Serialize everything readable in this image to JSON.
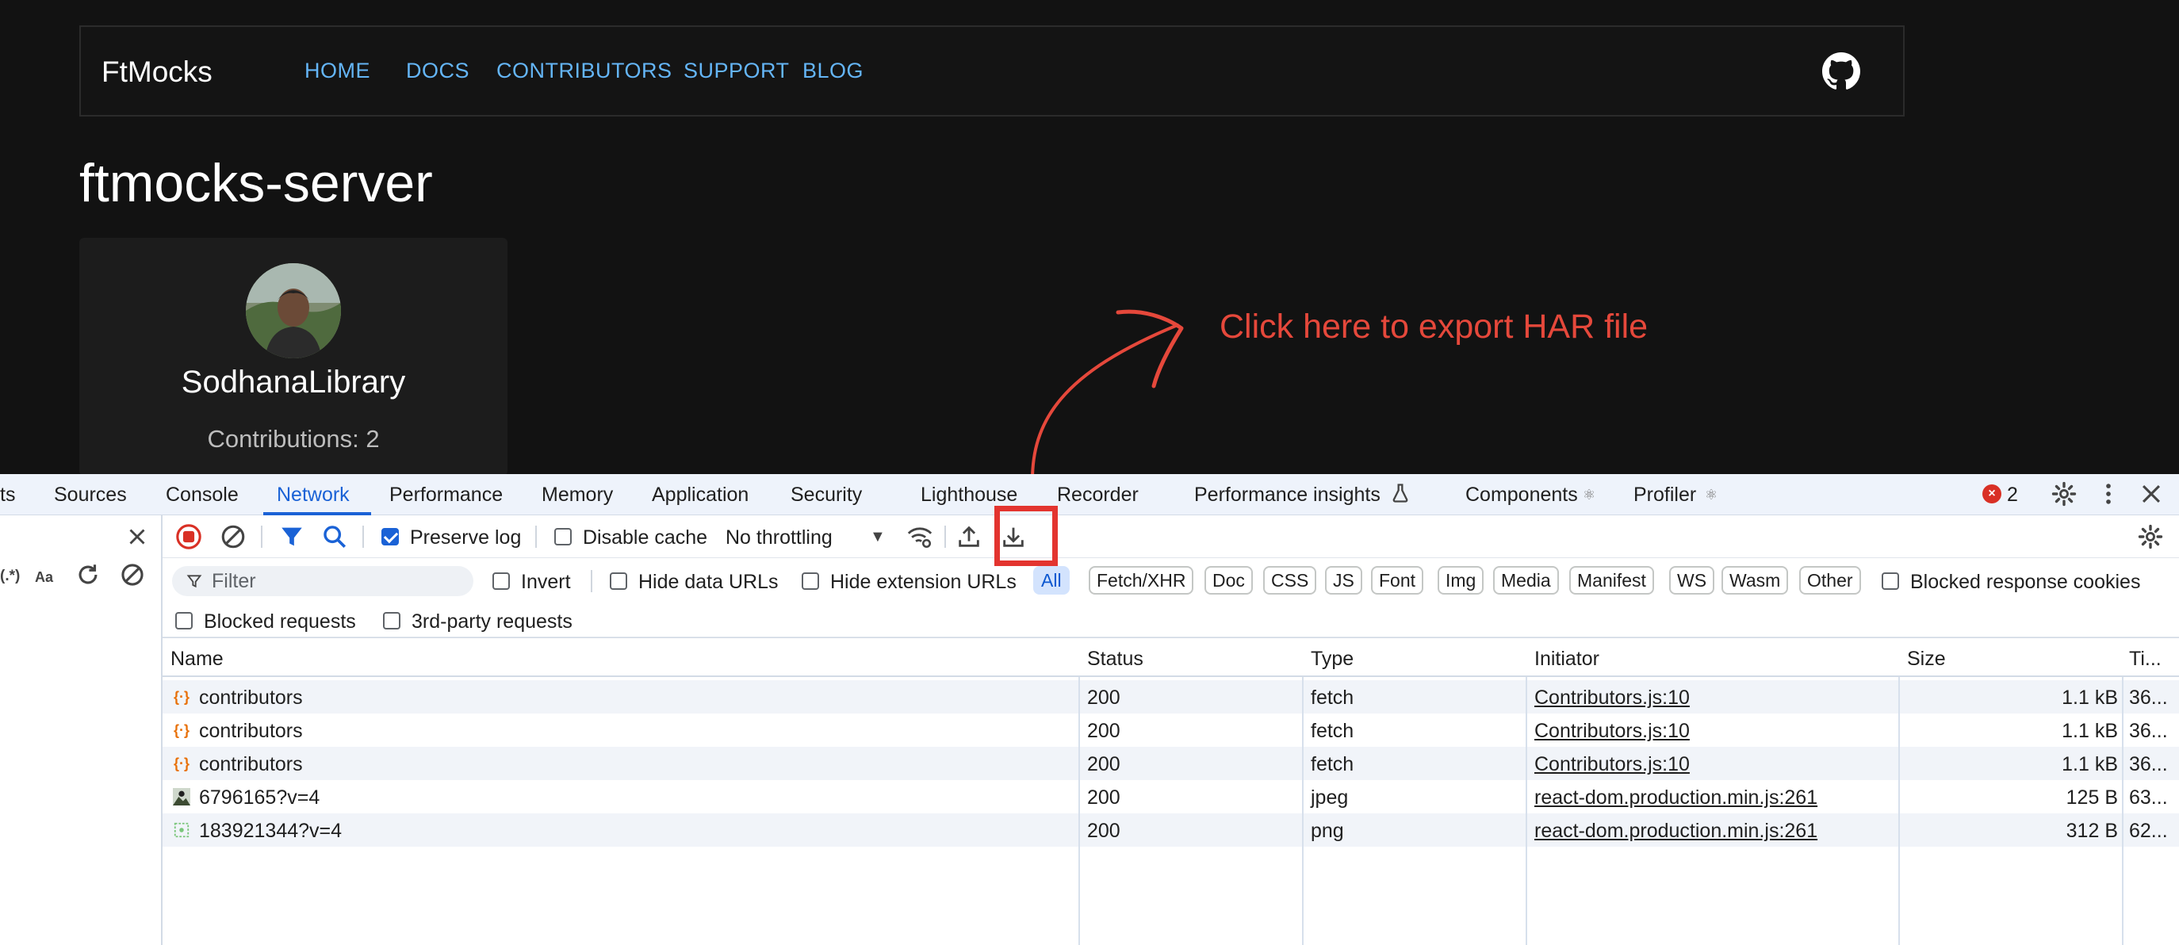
{
  "site": {
    "brand": "FtMocks",
    "nav": [
      "HOME",
      "DOCS",
      "CONTRIBUTORS",
      "SUPPORT",
      "BLOG"
    ],
    "github_icon": "github-icon",
    "page_title": "ftmocks-server",
    "card": {
      "name": "SodhanaLibrary",
      "contributions": "Contributions: 2"
    },
    "annotation": "Click here to export HAR file",
    "annotation_color": "#e5483b"
  },
  "devtools": {
    "tabs": [
      "ts",
      "Sources",
      "Console",
      "Network",
      "Performance",
      "Memory",
      "Application",
      "Security",
      "Lighthouse",
      "Recorder",
      "Performance insights",
      "Components",
      "Profiler"
    ],
    "active_tab": "Network",
    "error_count": "2",
    "toolbar": {
      "preserve_log": "Preserve log",
      "disable_cache": "Disable cache",
      "throttling": "No throttling"
    },
    "left_pane": {
      "regex_label": "(.*)",
      "case_label": "Aa"
    },
    "filter": {
      "placeholder": "Filter",
      "invert": "Invert",
      "hide_data_urls": "Hide data URLs",
      "hide_extension_urls": "Hide extension URLs",
      "types": [
        "All",
        "Fetch/XHR",
        "Doc",
        "CSS",
        "JS",
        "Font",
        "Img",
        "Media",
        "Manifest",
        "WS",
        "Wasm",
        "Other"
      ],
      "blocked_response_cookies": "Blocked response cookies",
      "blocked_requests": "Blocked requests",
      "third_party": "3rd-party requests"
    },
    "columns": [
      "Name",
      "Status",
      "Type",
      "Initiator",
      "Size",
      "Ti..."
    ],
    "rows": [
      {
        "name": "contributors",
        "status": "200",
        "type": "fetch",
        "initiator": "Contributors.js:10",
        "size": "1.1 kB",
        "time": "36..."
      },
      {
        "name": "contributors",
        "status": "200",
        "type": "fetch",
        "initiator": "Contributors.js:10",
        "size": "1.1 kB",
        "time": "36..."
      },
      {
        "name": "contributors",
        "status": "200",
        "type": "fetch",
        "initiator": "Contributors.js:10",
        "size": "1.1 kB",
        "time": "36..."
      },
      {
        "name": "6796165?v=4",
        "status": "200",
        "type": "jpeg",
        "initiator": "react-dom.production.min.js:261",
        "size": "125 B",
        "time": "63..."
      },
      {
        "name": "183921344?v=4",
        "status": "200",
        "type": "png",
        "initiator": "react-dom.production.min.js:261",
        "size": "312 B",
        "time": "62..."
      }
    ]
  }
}
